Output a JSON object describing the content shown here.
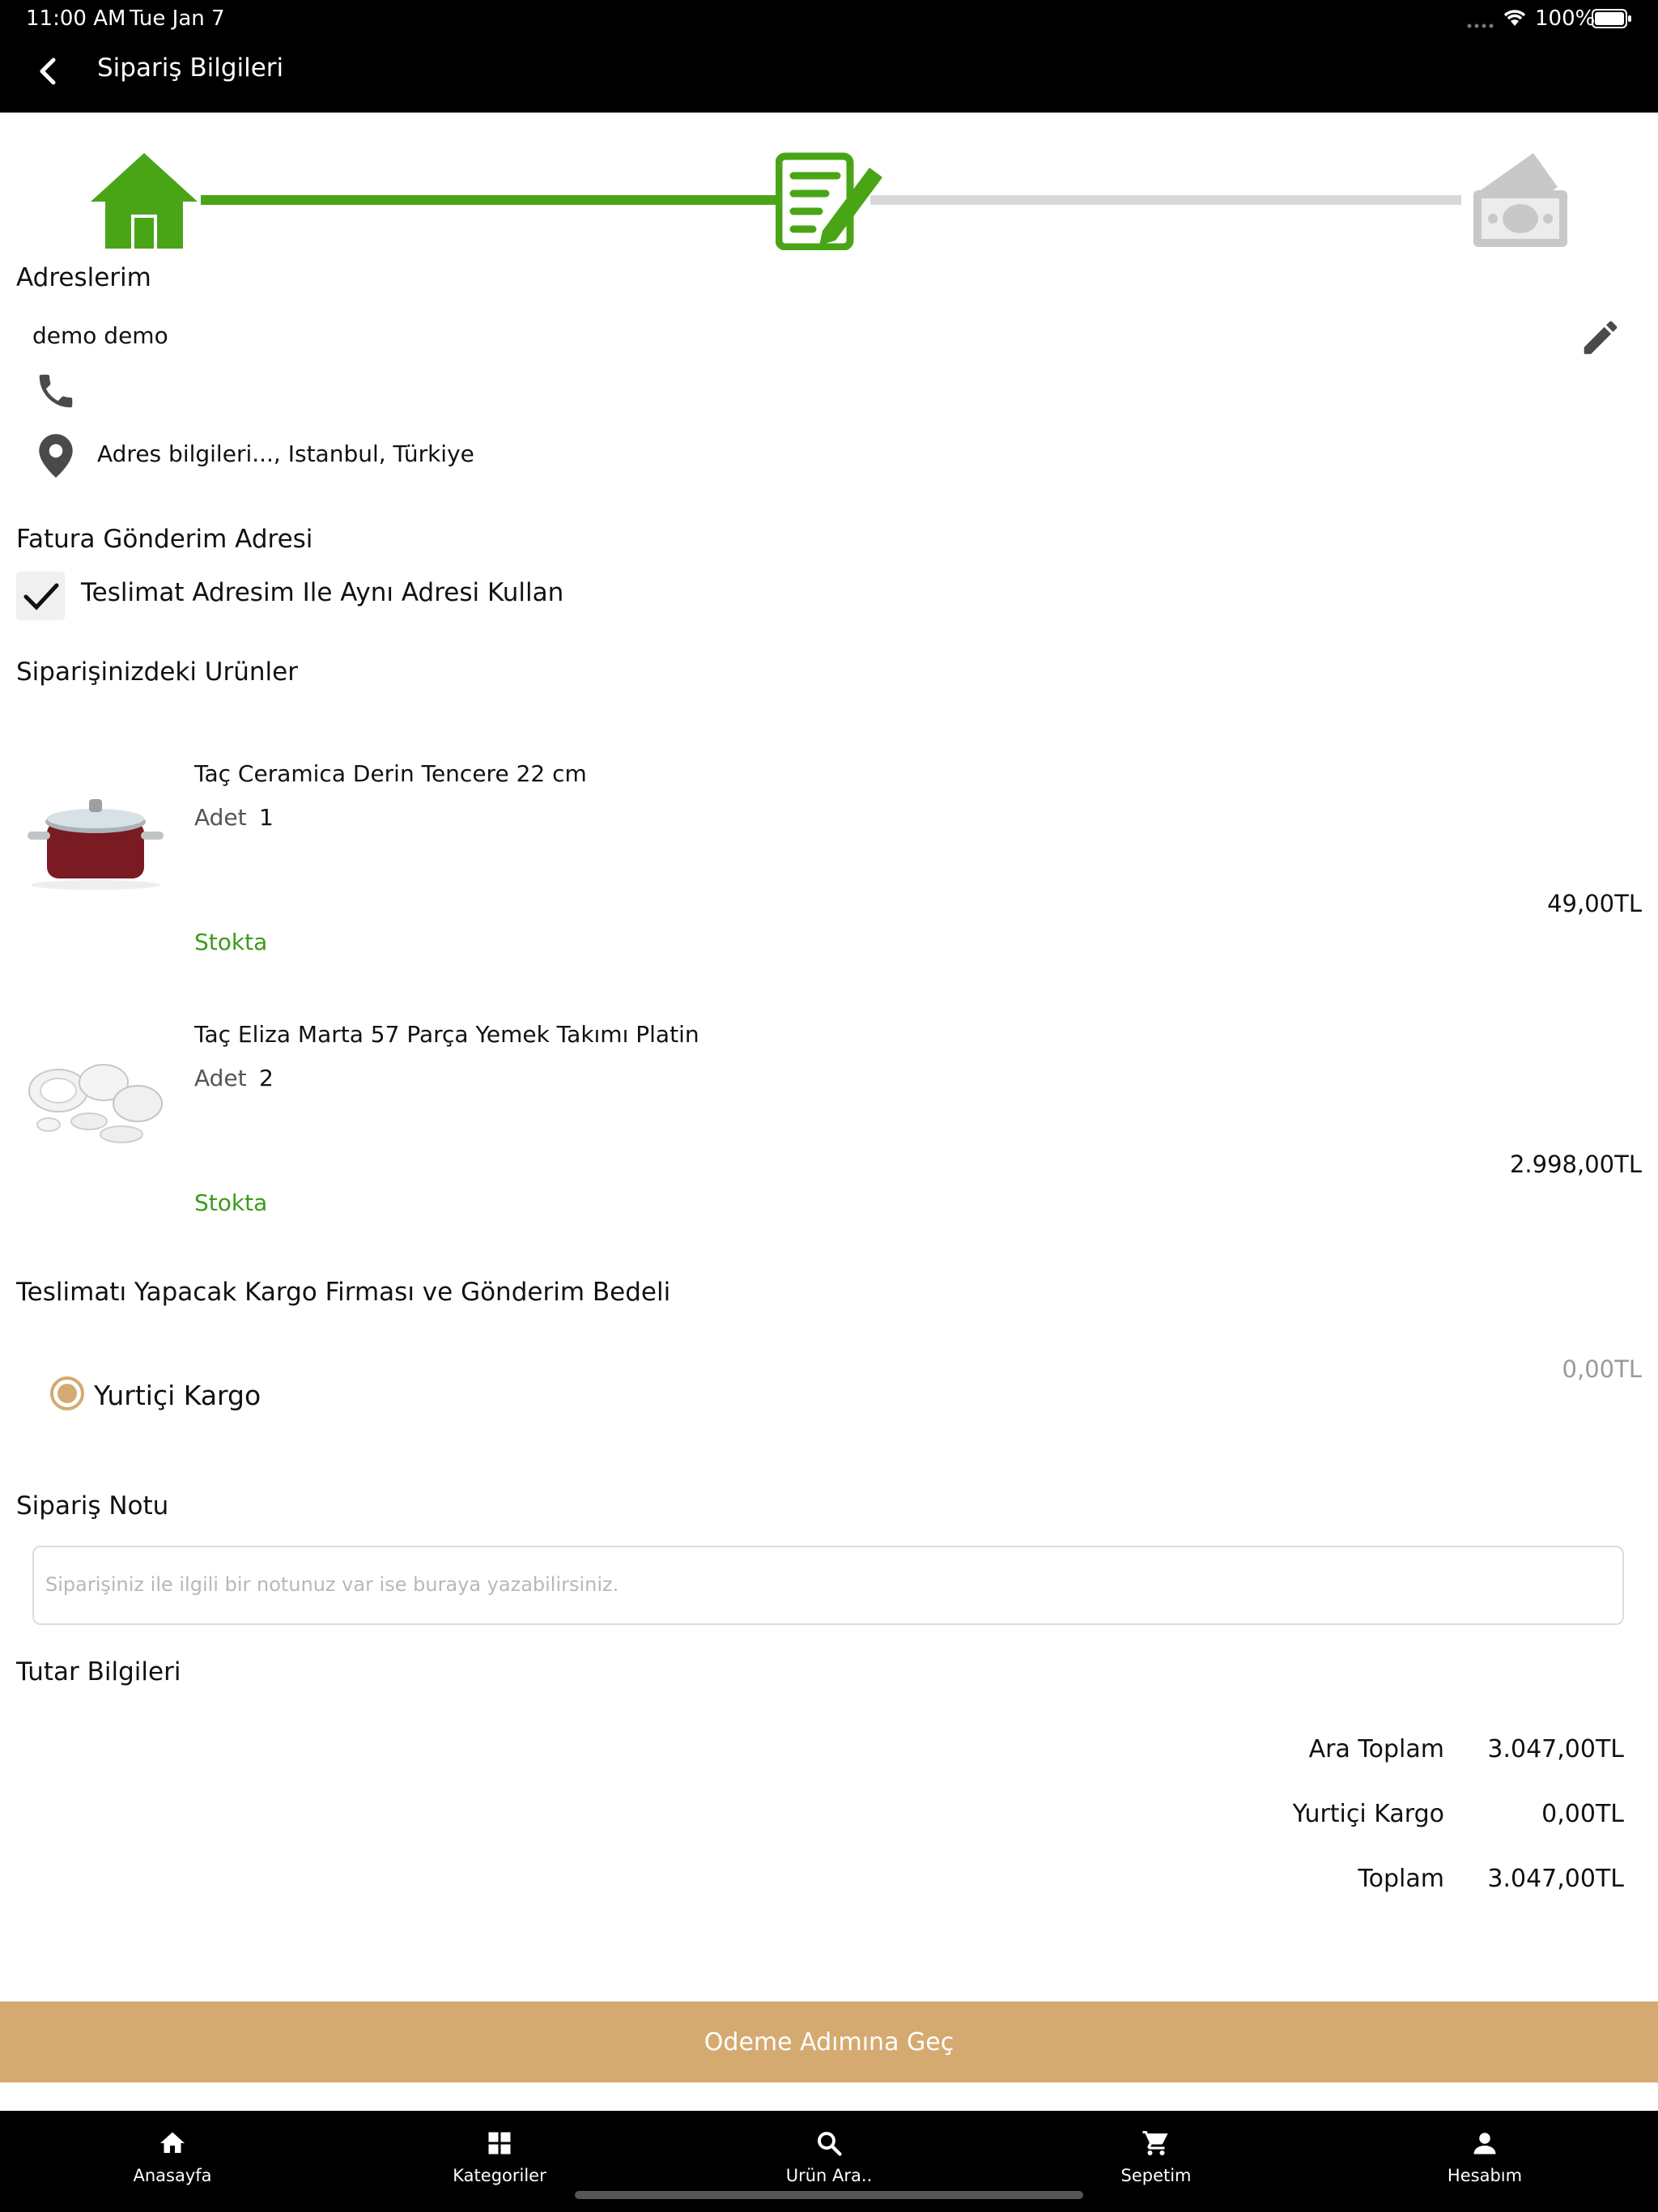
{
  "status_bar": {
    "time": "11:00 AM",
    "date": "Tue Jan 7",
    "battery": "100%"
  },
  "header": {
    "title": "Sipariş Bilgileri",
    "back_icon": "chevron-left-icon"
  },
  "stepper": {
    "steps": [
      {
        "icon": "home-icon",
        "state": "completed"
      },
      {
        "icon": "edit-document-icon",
        "state": "current"
      },
      {
        "icon": "money-icon",
        "state": "pending"
      }
    ],
    "active_color": "#4aa516",
    "inactive_color": "#d9d9d9"
  },
  "address": {
    "section_title": "Adreslerim",
    "name": "demo demo",
    "address_line": "Adres bilgileri..., Istanbul, Türkiye"
  },
  "billing": {
    "section_title": "Fatura Gönderim Adresi",
    "checkbox_label": "Teslimat Adresim Ile Aynı Adresi Kullan",
    "checked": true
  },
  "products": {
    "section_title": "Siparişinizdeki Urünler",
    "qty_label": "Adet",
    "items": [
      {
        "name": "Taç Ceramica Derin Tencere 22 cm",
        "qty": "1",
        "stock": "Stokta",
        "price": "49,00TL"
      },
      {
        "name": "Taç Eliza Marta 57 Parça Yemek Takımı Platin",
        "qty": "2",
        "stock": "Stokta",
        "price": "2.998,00TL"
      }
    ]
  },
  "shipping": {
    "section_title": "Teslimatı Yapacak Kargo Firması ve Gönderim Bedeli",
    "option_label": "Yurtiçi Kargo",
    "option_price": "0,00TL",
    "selected": true
  },
  "order_note": {
    "section_title": "Sipariş Notu",
    "placeholder": "Siparişiniz ile ilgili bir notunuz var ise buraya yazabilirsiniz."
  },
  "totals": {
    "section_title": "Tutar Bilgileri",
    "subtotal_label": "Ara Toplam",
    "subtotal_value": "3.047,00TL",
    "shipping_label": "Yurtiçi Kargo",
    "shipping_value": "0,00TL",
    "total_label": "Toplam",
    "total_value": "3.047,00TL"
  },
  "cta": {
    "label": "Odeme Adımına Geç",
    "color": "#d4aa71"
  },
  "tabbar": {
    "tabs": [
      {
        "label": "Anasayfa",
        "icon": "home-icon"
      },
      {
        "label": "Kategoriler",
        "icon": "grid-icon"
      },
      {
        "label": "Urün Ara..",
        "icon": "search-icon"
      },
      {
        "label": "Sepetim",
        "icon": "cart-icon"
      },
      {
        "label": "Hesabım",
        "icon": "person-icon"
      }
    ]
  }
}
